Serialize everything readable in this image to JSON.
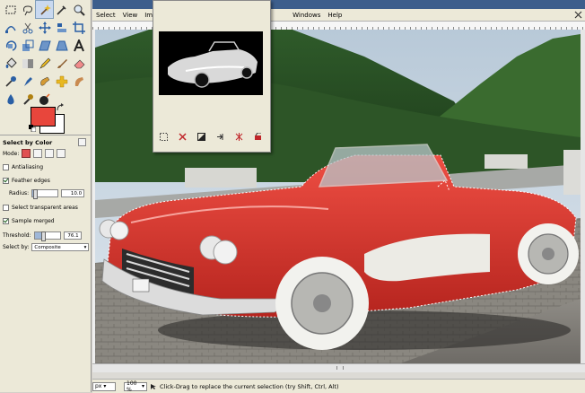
{
  "menubar": {
    "items": [
      "Select",
      "View",
      "Im",
      "Windows",
      "Help"
    ]
  },
  "toolbox": {
    "tools": [
      "rect-select-icon",
      "lasso-icon",
      "fuzzy-select-icon",
      "color-picker-icon",
      "zoom-icon",
      "paths-icon",
      "scissors-icon",
      "move-icon",
      "align-icon",
      "crop-icon",
      "rotate-icon",
      "scale-icon",
      "shear-icon",
      "perspective-icon",
      "text-icon",
      "bucket-fill-icon",
      "blend-icon",
      "pencil-icon",
      "paintbrush-icon",
      "eraser-icon",
      "airbrush-icon",
      "ink-icon",
      "clone-icon",
      "heal-icon",
      "smudge-icon",
      "blur-icon",
      "dodge-icon",
      "bomb-icon"
    ],
    "active_tool": 2,
    "fg_color": "#e8463c",
    "bg_color": "#ffffff"
  },
  "tool_options": {
    "title": "Select by Color",
    "mode_label": "Mode:",
    "antialiasing_label": "Antialiasing",
    "antialiasing": false,
    "feather_label": "Feather edges",
    "feather": true,
    "radius_label": "Radius:",
    "radius_value": "10.0",
    "radius_fraction": 0.1,
    "transparent_label": "Select transparent areas",
    "transparent": false,
    "sample_merged_label": "Sample merged",
    "sample_merged": true,
    "threshold_label": "Threshold:",
    "threshold_value": "76.1",
    "threshold_fraction": 0.3,
    "select_by_label": "Select by:",
    "select_by_value": "Composite"
  },
  "status": {
    "unit": "px",
    "zoom": "100 %",
    "message": "Click-Drag to replace the current selection (try Shift, Ctrl, Alt)"
  },
  "colors": {
    "car_red": "#d8352c",
    "accent": "#3d5e8c"
  }
}
